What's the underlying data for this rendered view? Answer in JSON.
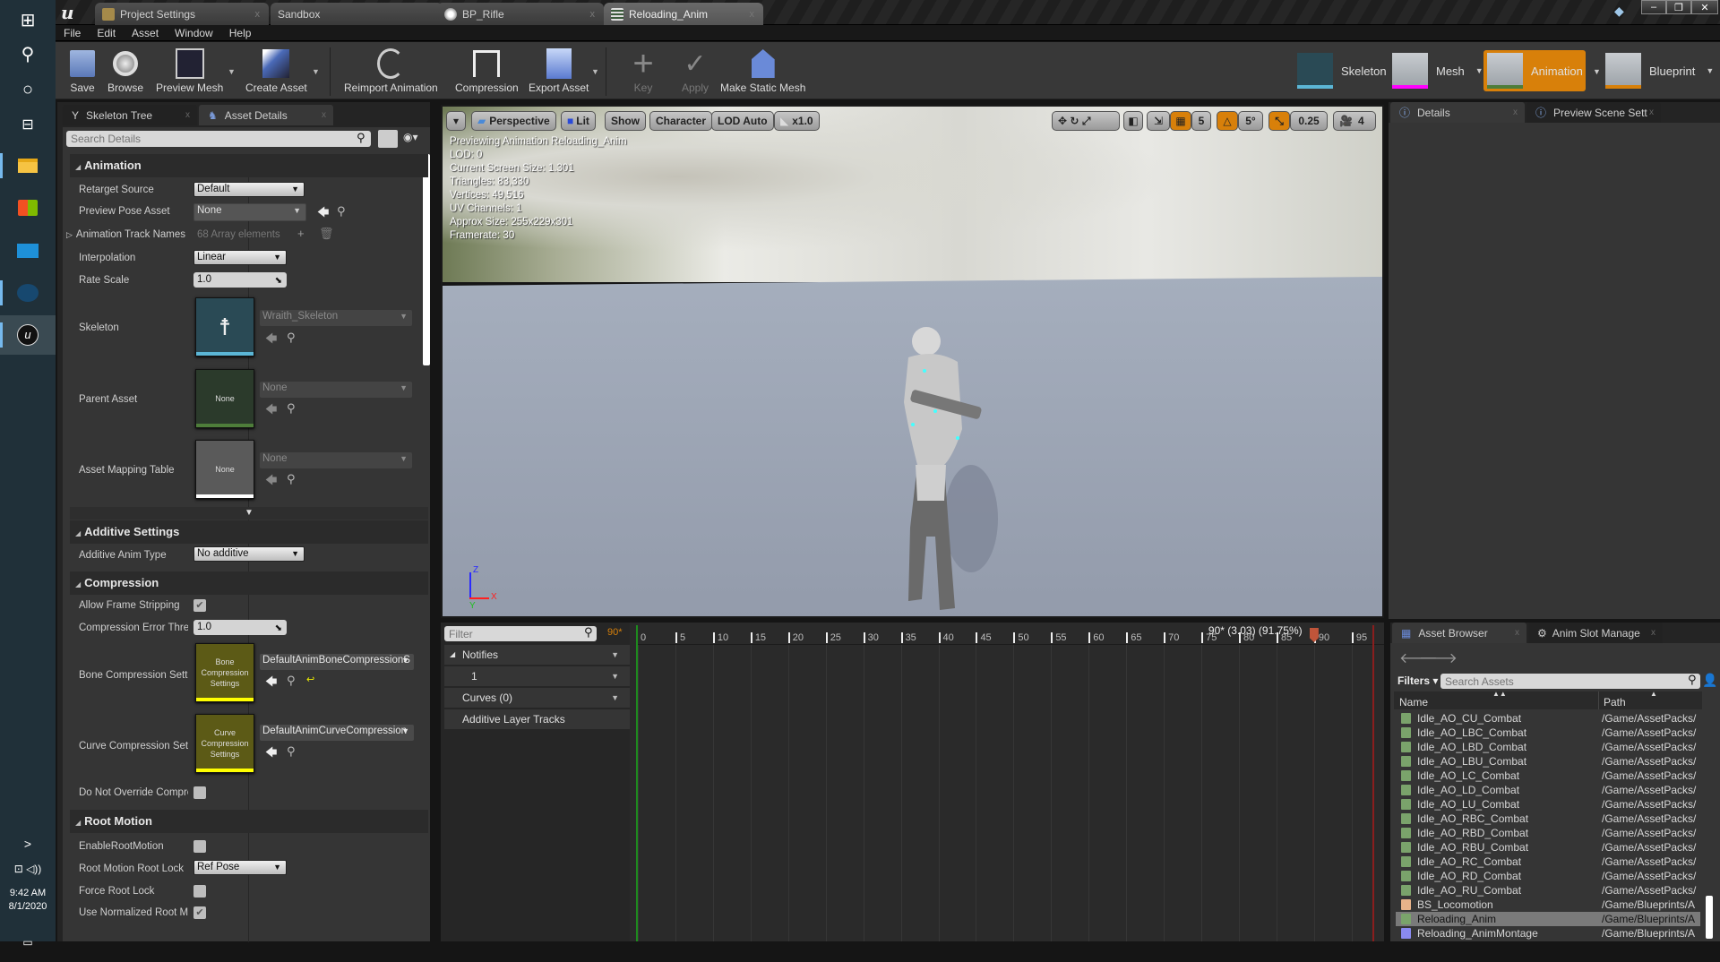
{
  "taskbar": {
    "icons": [
      "windows-start",
      "search",
      "cortana",
      "task-view",
      "file-explorer",
      "microsoft-store",
      "mail",
      "steam",
      "unreal-engine"
    ],
    "time": "9:42 AM",
    "date": "8/1/2020"
  },
  "title_tabs": [
    {
      "label": "Project Settings",
      "icon": "settings"
    },
    {
      "label": "Sandbox",
      "icon": ""
    },
    {
      "label": "BP_Rifle",
      "icon": "blueprint-sphere"
    },
    {
      "label": "Reloading_Anim",
      "icon": "anim-sequence",
      "active": true
    }
  ],
  "window_controls": {
    "minimize": "–",
    "restore": "❐",
    "close": "✕"
  },
  "menu": [
    "File",
    "Edit",
    "Asset",
    "Window",
    "Help"
  ],
  "toolbar": {
    "save": "Save",
    "browse": "Browse",
    "preview_mesh": "Preview Mesh",
    "create_asset": "Create Asset",
    "reimport_animation": "Reimport Animation",
    "compression": "Compression",
    "export_asset": "Export Asset",
    "key": "Key",
    "apply": "Apply",
    "make_static_mesh": "Make Static Mesh"
  },
  "modes": [
    {
      "label": "Skeleton",
      "color": "#5bb6d6"
    },
    {
      "label": "Mesh",
      "color": "#ff00ff"
    },
    {
      "label": "Animation",
      "color": "#4e7d3a",
      "active": true
    },
    {
      "label": "Blueprint",
      "color": "#d8800a"
    }
  ],
  "left_panel": {
    "tabs": [
      "Skeleton Tree",
      "Asset Details"
    ],
    "search_placeholder": "Search Details",
    "sections": {
      "animation": {
        "title": "Animation",
        "retarget_source": {
          "label": "Retarget Source",
          "value": "Default"
        },
        "preview_pose_asset": {
          "label": "Preview Pose Asset",
          "value": "None"
        },
        "animation_track_names": {
          "label": "Animation Track Names",
          "value": "68 Array elements"
        },
        "interpolation": {
          "label": "Interpolation",
          "value": "Linear"
        },
        "rate_scale": {
          "label": "Rate Scale",
          "value": "1.0"
        },
        "skeleton": {
          "label": "Skeleton",
          "value": "Wraith_Skeleton"
        },
        "parent_asset": {
          "label": "Parent Asset",
          "value": "None",
          "thumb": "None"
        },
        "asset_mapping_table": {
          "label": "Asset Mapping Table",
          "value": "None",
          "thumb": "None"
        }
      },
      "additive": {
        "title": "Additive Settings",
        "additive_anim_type": {
          "label": "Additive Anim Type",
          "value": "No additive"
        }
      },
      "compression": {
        "title": "Compression",
        "allow_frame_stripping": {
          "label": "Allow Frame Stripping",
          "checked": true
        },
        "compression_error_threshold": {
          "label": "Compression Error Thres",
          "value": "1.0"
        },
        "bone_compression": {
          "label": "Bone Compression Setti",
          "value": "DefaultAnimBoneCompressionS",
          "thumb": "Bone Compression Settings"
        },
        "curve_compression": {
          "label": "Curve Compression Sett",
          "value": "DefaultAnimCurveCompression",
          "thumb": "Curve Compression Settings"
        },
        "do_not_override": {
          "label": "Do Not Override Compre",
          "checked": false
        }
      },
      "root_motion": {
        "title": "Root Motion",
        "enable_root_motion": {
          "label": "EnableRootMotion",
          "checked": false
        },
        "root_motion_root_lock": {
          "label": "Root Motion Root Lock",
          "value": "Ref Pose"
        },
        "force_root_lock": {
          "label": "Force Root Lock",
          "checked": false
        },
        "use_normalized_root_motion": {
          "label": "Use Normalized Root Mo",
          "checked": true
        }
      }
    }
  },
  "viewport": {
    "buttons": {
      "menu": "▾",
      "perspective": "Perspective",
      "lit": "Lit",
      "show": "Show",
      "character": "Character",
      "lod": "LOD Auto",
      "speed": "x1.0"
    },
    "snap": {
      "grid": "5",
      "rotation": "5°",
      "scale": "0.25",
      "camera_speed": "4"
    },
    "stats": [
      "Previewing Animation Reloading_Anim",
      "LOD: 0",
      "Current Screen Size: 1.301",
      "Triangles: 83,330",
      "Vertices: 49,516",
      "UV Channels: 1",
      "Approx Size: 255x229x301",
      "Framerate: 30"
    ],
    "axis": {
      "z": "Z",
      "x": "X",
      "y": "Y"
    }
  },
  "right_panel": {
    "tabs": [
      "Details",
      "Preview Scene Sett"
    ]
  },
  "timeline": {
    "filter_placeholder": "Filter",
    "frame_count": "90*",
    "tracks": [
      {
        "label": "Notifies",
        "expanded": true
      },
      {
        "label": "1"
      },
      {
        "label": "Curves  (0)"
      },
      {
        "label": "Additive Layer Tracks"
      }
    ],
    "ticks": [
      "0",
      "5",
      "10",
      "15",
      "20",
      "25",
      "30",
      "35",
      "40",
      "45",
      "50",
      "55",
      "60",
      "65",
      "70",
      "75",
      "80",
      "85",
      "90",
      "95"
    ],
    "playhead_label": "90* (3.03) (91.75%)",
    "playhead_frame": 90,
    "total_frames": 98
  },
  "asset_browser": {
    "tabs": [
      "Asset Browser",
      "Anim Slot Manage"
    ],
    "filters_label": "Filters",
    "search_placeholder": "Search Assets",
    "columns": [
      "Name",
      "Path"
    ],
    "rows": [
      {
        "name": "Idle_AO_CU_Combat",
        "path": "/Game/AssetPacks/",
        "type": "aimoffset"
      },
      {
        "name": "Idle_AO_LBC_Combat",
        "path": "/Game/AssetPacks/",
        "type": "aimoffset"
      },
      {
        "name": "Idle_AO_LBD_Combat",
        "path": "/Game/AssetPacks/",
        "type": "aimoffset"
      },
      {
        "name": "Idle_AO_LBU_Combat",
        "path": "/Game/AssetPacks/",
        "type": "aimoffset"
      },
      {
        "name": "Idle_AO_LC_Combat",
        "path": "/Game/AssetPacks/",
        "type": "aimoffset"
      },
      {
        "name": "Idle_AO_LD_Combat",
        "path": "/Game/AssetPacks/",
        "type": "aimoffset"
      },
      {
        "name": "Idle_AO_LU_Combat",
        "path": "/Game/AssetPacks/",
        "type": "aimoffset"
      },
      {
        "name": "Idle_AO_RBC_Combat",
        "path": "/Game/AssetPacks/",
        "type": "aimoffset"
      },
      {
        "name": "Idle_AO_RBD_Combat",
        "path": "/Game/AssetPacks/",
        "type": "aimoffset"
      },
      {
        "name": "Idle_AO_RBU_Combat",
        "path": "/Game/AssetPacks/",
        "type": "aimoffset"
      },
      {
        "name": "Idle_AO_RC_Combat",
        "path": "/Game/AssetPacks/",
        "type": "aimoffset"
      },
      {
        "name": "Idle_AO_RD_Combat",
        "path": "/Game/AssetPacks/",
        "type": "aimoffset"
      },
      {
        "name": "Idle_AO_RU_Combat",
        "path": "/Game/AssetPacks/",
        "type": "aimoffset"
      },
      {
        "name": "BS_Locomotion",
        "path": "/Game/Blueprints/A",
        "type": "blendspace"
      },
      {
        "name": "Reloading_Anim",
        "path": "/Game/Blueprints/A",
        "type": "sequence",
        "selected": true
      },
      {
        "name": "Reloading_AnimMontage",
        "path": "/Game/Blueprints/A",
        "type": "montage"
      }
    ]
  },
  "colors": {
    "accent": "#d8800a",
    "aimoffset_icon": "#7aa36b",
    "blendspace_icon": "#e8b38a",
    "montage_icon": "#8a8af0",
    "compression_thumb": "#5c5a16",
    "compression_bar": "#ffff00"
  }
}
